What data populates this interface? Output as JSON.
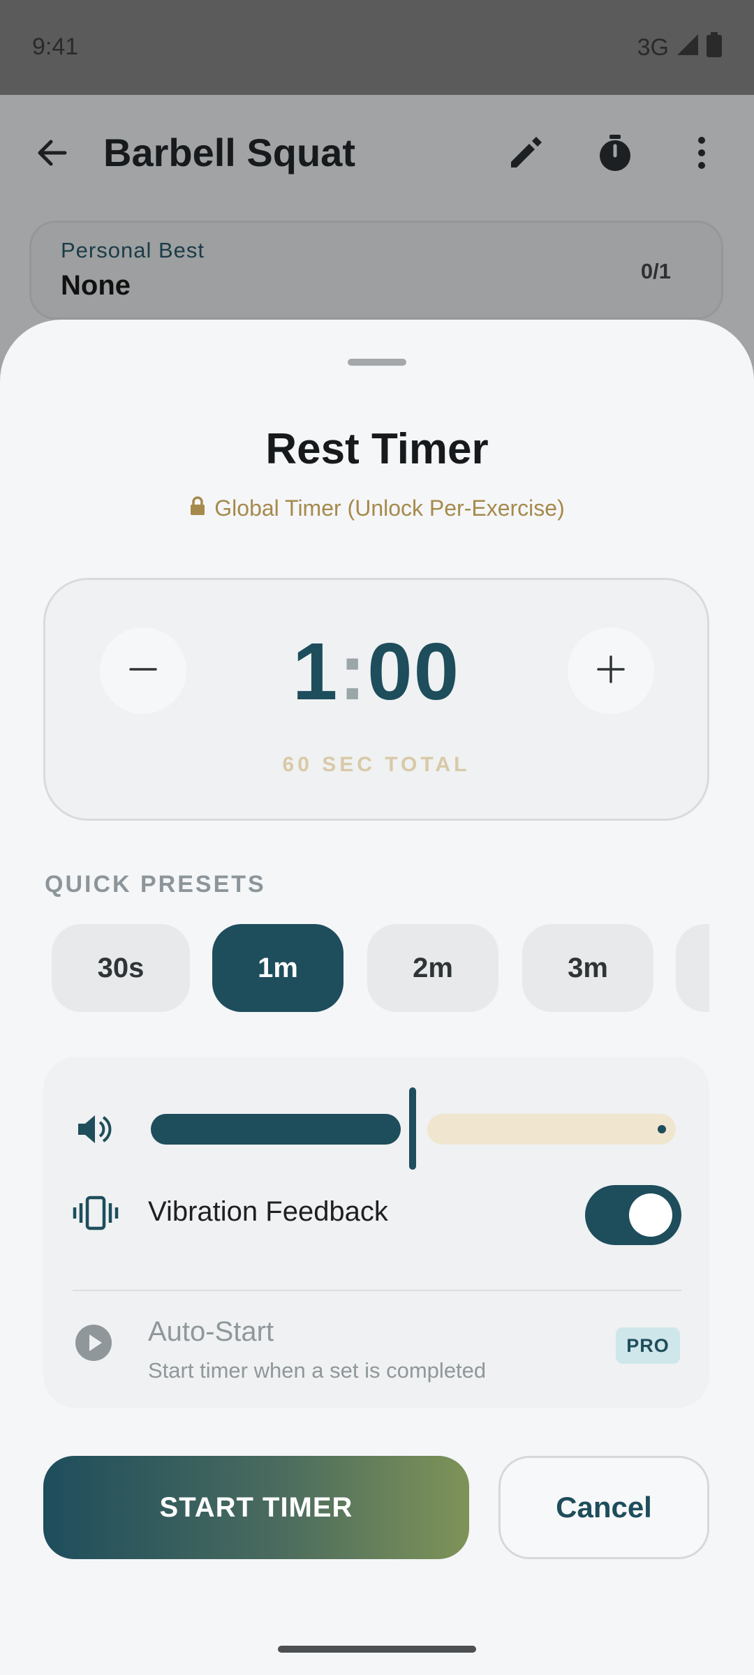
{
  "status_bar": {
    "time": "9:41",
    "network": "3G",
    "icons": [
      "signal-icon",
      "battery-icon"
    ]
  },
  "app_bar": {
    "title": "Barbell Squat",
    "icons": [
      "back-arrow-icon",
      "edit-pencil-icon",
      "stopwatch-icon",
      "more-vert-icon"
    ]
  },
  "personal_best": {
    "label": "Personal Best",
    "value": "None",
    "count": "0/1"
  },
  "sheet": {
    "title": "Rest Timer",
    "subtitle": "Global Timer (Unlock Per-Exercise)",
    "timer": {
      "minutes": "1",
      "colon": ":",
      "seconds": "00",
      "total": "60 SEC TOTAL"
    },
    "presets_label": "QUICK PRESETS",
    "presets": [
      {
        "label": "30s",
        "selected": false
      },
      {
        "label": "1m",
        "selected": true
      },
      {
        "label": "2m",
        "selected": false
      },
      {
        "label": "3m",
        "selected": false
      },
      {
        "label": "",
        "selected": false
      }
    ],
    "volume": {
      "level": 0.5
    },
    "vibration": {
      "label": "Vibration Feedback",
      "enabled": true
    },
    "auto_start": {
      "title": "Auto-Start",
      "description": "Start timer when a set is completed",
      "badge": "PRO"
    },
    "start_label": "START TIMER",
    "cancel_label": "Cancel"
  },
  "colors": {
    "primary": "#1e4d5c",
    "accent_gold": "#a58a4b",
    "track_remaining": "#f0e6cf",
    "gradient_end": "#7f9358"
  }
}
